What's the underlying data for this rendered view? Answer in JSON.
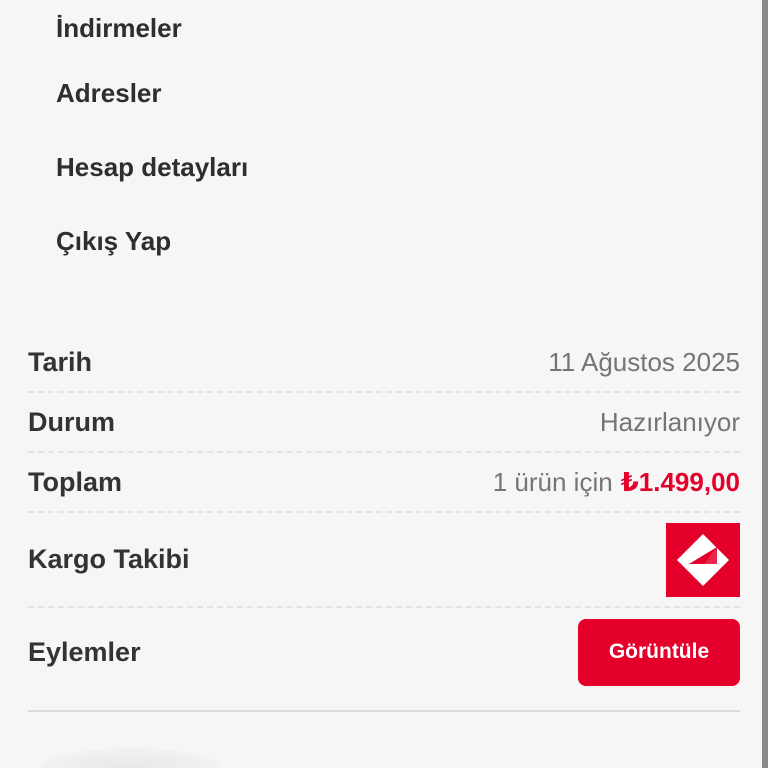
{
  "account_nav": {
    "items": [
      {
        "label": "İndirmeler"
      },
      {
        "label": "Adresler"
      },
      {
        "label": "Hesap detayları"
      },
      {
        "label": "Çıkış Yap"
      }
    ]
  },
  "order": {
    "date_label": "Tarih",
    "date_value": "11 Ağustos 2025",
    "status_label": "Durum",
    "status_value": "Hazırlanıyor",
    "total_label": "Toplam",
    "total_prefix": "1 ürün için",
    "total_price": "₺1.499,00",
    "cargo_label": "Kargo Takibi",
    "cargo_logo_icon": "aras-kargo-logo-icon",
    "actions_label": "Eylemler",
    "view_button_label": "Görüntüle"
  },
  "colors": {
    "accent": "#e4002b",
    "background": "#f6f6f6",
    "text": "#333333",
    "muted_text": "#757575"
  }
}
